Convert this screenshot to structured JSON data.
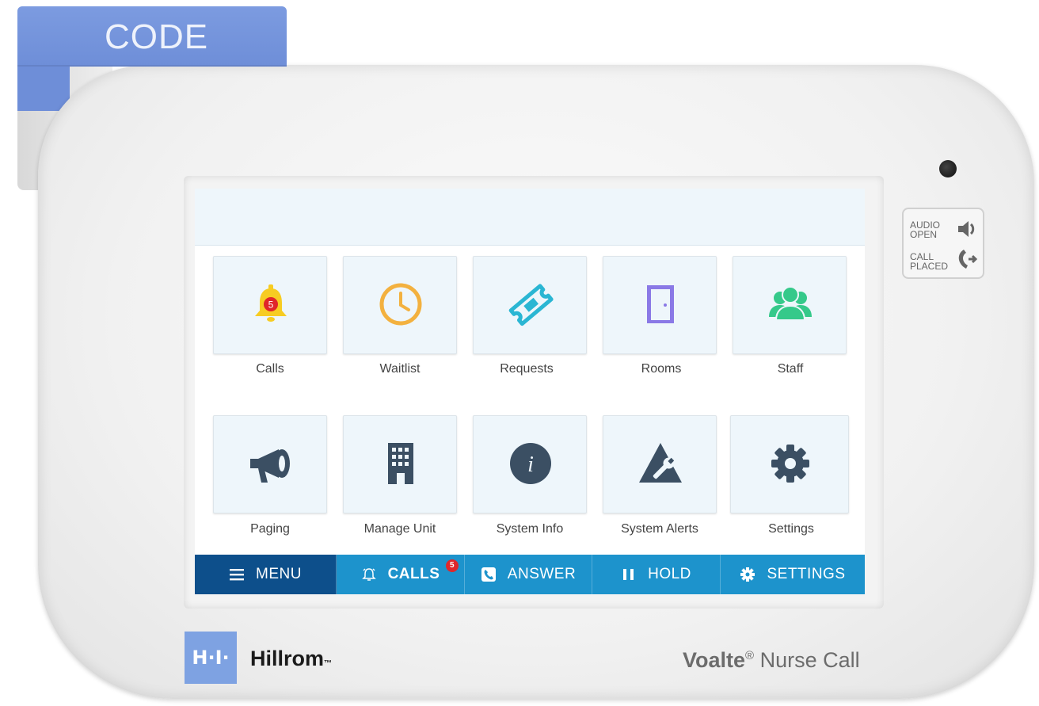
{
  "device": {
    "code_label": "CODE",
    "brand_logo_text": "H·I·",
    "brand_name": "Hillrom",
    "brand_tm": "™",
    "product_brand": "Voalte",
    "product_reg": "®",
    "product_name": " Nurse Call"
  },
  "indicators": {
    "audio_line1": "AUDIO",
    "audio_line2": "OPEN",
    "call_line1": "CALL",
    "call_line2": "PLACED"
  },
  "tiles": [
    {
      "label": "Calls",
      "icon": "bell-icon",
      "badge": "5",
      "color": "#f7cc22"
    },
    {
      "label": "Waitlist",
      "icon": "clock-icon",
      "color": "#f3b13f"
    },
    {
      "label": "Requests",
      "icon": "ticket-icon",
      "color": "#2ab6d3"
    },
    {
      "label": "Rooms",
      "icon": "door-icon",
      "color": "#8a79e6"
    },
    {
      "label": "Staff",
      "icon": "people-icon",
      "color": "#35c98a"
    },
    {
      "label": "Paging",
      "icon": "megaphone-icon",
      "color": "#3b4f63"
    },
    {
      "label": "Manage Unit",
      "icon": "building-icon",
      "color": "#3b4f63"
    },
    {
      "label": "System Info",
      "icon": "info-icon",
      "color": "#3b4f63"
    },
    {
      "label": "System Alerts",
      "icon": "alert-wrench-icon",
      "color": "#3b4f63"
    },
    {
      "label": "Settings",
      "icon": "gear-icon",
      "color": "#3b4f63"
    }
  ],
  "nav": {
    "menu": "MENU",
    "calls": "CALLS",
    "calls_badge": "5",
    "answer": "ANSWER",
    "hold": "HOLD",
    "settings": "SETTINGS"
  }
}
